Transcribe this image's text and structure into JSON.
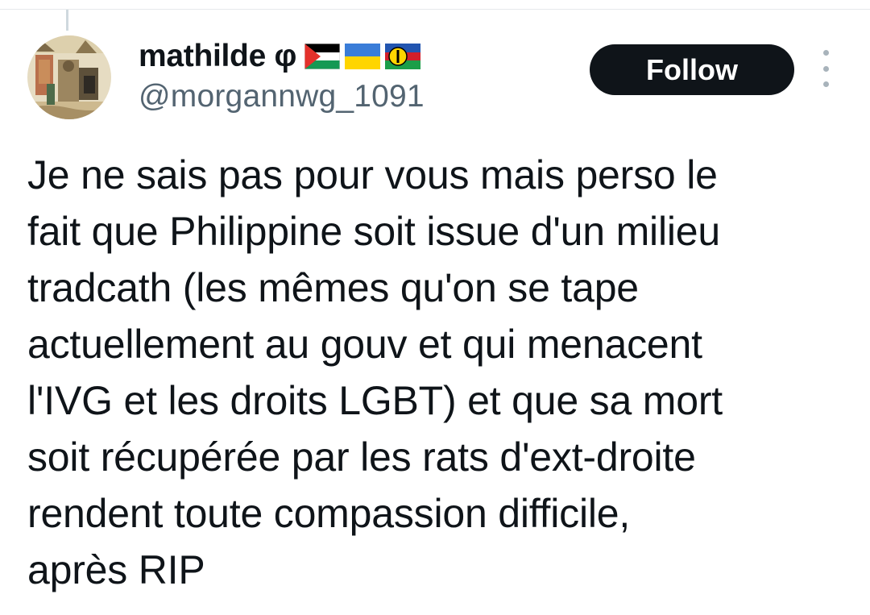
{
  "tweet": {
    "author": {
      "display_name": "mathilde φ",
      "handle": "@morgannwg_1091",
      "flags": [
        "palestine-flag",
        "ukraine-flag",
        "kanaky-flag"
      ]
    },
    "follow_label": "Follow",
    "more_icon": "more-vertical-icon",
    "text_lines": [
      "Je ne sais pas pour vous mais perso le",
      "fait que Philippine soit issue d'un milieu",
      "tradcath (les mêmes qu'on se tape",
      "actuellement au gouv et qui menacent",
      "l'IVG et les droits LGBT) et que sa mort",
      "soit récupérée par les rats d'ext-droite",
      "rendent toute compassion difficile,",
      "après RIP"
    ]
  },
  "colors": {
    "follow_bg": "#0f1419",
    "follow_text": "#ffffff",
    "handle": "#536471",
    "text": "#0f1419"
  }
}
